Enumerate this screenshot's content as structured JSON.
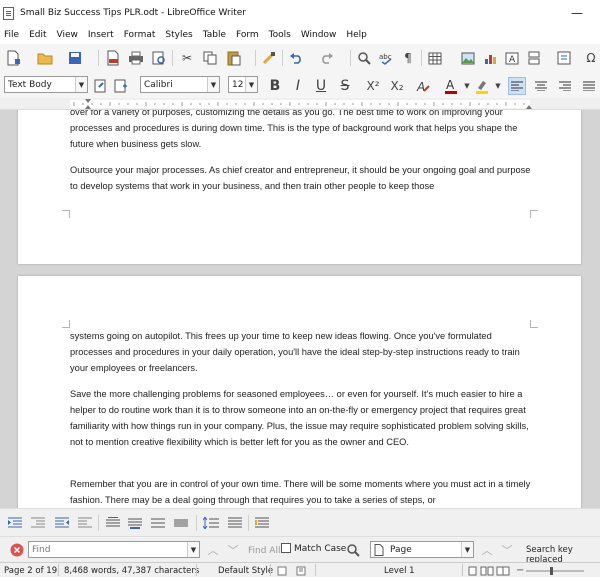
{
  "window": {
    "title": "Small Biz Success Tips PLR.odt - LibreOffice Writer",
    "minimize_glyph": "—"
  },
  "menu": [
    "File",
    "Edit",
    "View",
    "Insert",
    "Format",
    "Styles",
    "Table",
    "Form",
    "Tools",
    "Window",
    "Help"
  ],
  "toolbar": {
    "paragraph_style": "Text Body",
    "font_name": "Calibri",
    "font_size": "12",
    "bold": "B",
    "italic": "I",
    "underline": "U",
    "strikethrough": "S",
    "superscript": "X²",
    "subscript": "X₂"
  },
  "document": {
    "page1_paragraphs": [
      "over for a variety of purposes, customizing the details as you go. The best time to work on improving your processes and procedures is during down time. This is the type of background work that helps you shape the future when business gets slow.",
      "Outsource your major processes. As chief creator and entrepreneur, it should be your ongoing goal and purpose to develop systems that work in your business, and then train other people to keep those"
    ],
    "page2_paragraphs": [
      "systems going on autopilot. This frees up your time to keep new ideas flowing. Once you've formulated processes and procedures in your daily operation, you'll have the ideal step-by-step instructions ready to train your employees or freelancers.",
      "Save the more challenging problems for seasoned employees… or even for yourself. It's much easier to hire a helper to do routine work than it is to throw someone into an on-the-fly or emergency project that requires great familiarity with how things run in your company. Plus, the issue may require sophisticated problem solving skills, not to mention creative flexibility which is better left for you as the owner and CEO.",
      "Remember that you are in control of your own time. There will be some moments where you must act in a timely fashion. There may be a deal going through that requires you to take a series of steps, or"
    ]
  },
  "findbar": {
    "placeholder": "Find",
    "find_all": "Find All",
    "match_case": "Match Case",
    "search_scope": "Page",
    "status": "Search key replaced"
  },
  "statusbar": {
    "page": "Page 2 of 19",
    "words": "8,468 words, 47,387 characters",
    "page_style": "Default Style",
    "outline_level": "Level 1"
  },
  "colors": {
    "accent": "#3a66b5",
    "font_color": "#c00000",
    "highlight": "#ffd200"
  }
}
